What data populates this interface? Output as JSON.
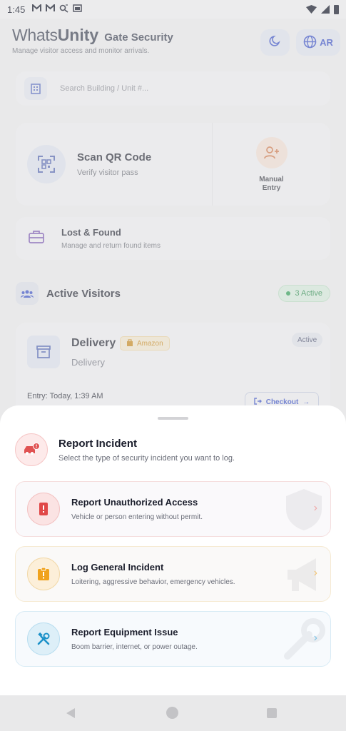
{
  "status_bar": {
    "time": "1:45",
    "icons": [
      "mail-icon",
      "mail-icon",
      "call-icon",
      "cast-icon"
    ]
  },
  "header": {
    "brand_part1": "Whats",
    "brand_part2": "Unity",
    "brand_suffix": "Gate Security",
    "subtitle": "Manage visitor access and monitor arrivals.",
    "lang_label": "AR"
  },
  "search": {
    "placeholder": "Search Building / Unit #..."
  },
  "scan_card": {
    "title": "Scan QR Code",
    "subtitle": "Verify visitor pass",
    "manual_label": "Manual Entry"
  },
  "lost_found": {
    "title": "Lost & Found",
    "subtitle": "Manage and return found items"
  },
  "active_visitors": {
    "title": "Active Visitors",
    "badge": "3 Active"
  },
  "visitor_card": {
    "name": "Delivery",
    "tag": "Amazon",
    "type": "Delivery",
    "status": "Active",
    "entry": "Entry: Today, 1:39 AM",
    "checkout_label": "Checkout"
  },
  "sheet": {
    "title": "Report Incident",
    "subtitle": "Select the type of security incident you want to log.",
    "options": [
      {
        "title": "Report Unauthorized Access",
        "subtitle": "Vehicle or person entering without permit."
      },
      {
        "title": "Log General Incident",
        "subtitle": "Loitering, aggressive behavior, emergency vehicles."
      },
      {
        "title": "Report Equipment Issue",
        "subtitle": "Boom barrier, internet, or power outage."
      }
    ]
  },
  "colors": {
    "accent": "#3b52c8",
    "danger": "#e04848",
    "warning": "#f0a21c",
    "info": "#1c91c8",
    "success": "#2f9e57"
  }
}
